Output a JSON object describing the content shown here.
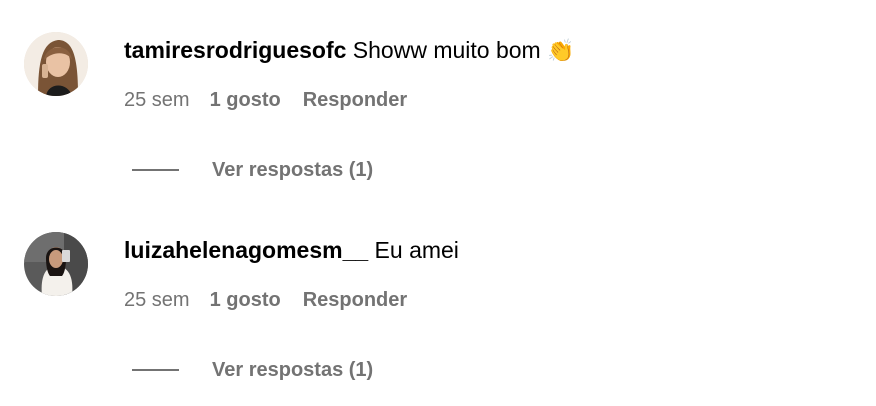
{
  "comments": [
    {
      "username": "tamiresrodriguesofc",
      "text": "Showw muito bom",
      "emoji": "👏",
      "time": "25 sem",
      "likes": "1 gosto",
      "reply": "Responder",
      "view_replies": "Ver respostas (1)",
      "avatar_icon": "user-avatar-photo"
    },
    {
      "username": "luizahelenagomesm__",
      "text": "Eu amei",
      "emoji": "",
      "time": "25 sem",
      "likes": "1 gosto",
      "reply": "Responder",
      "view_replies": "Ver respostas (1)",
      "avatar_icon": "user-avatar-photo"
    }
  ],
  "colors": {
    "secondary_text": "#737373",
    "primary_text": "#000000"
  }
}
